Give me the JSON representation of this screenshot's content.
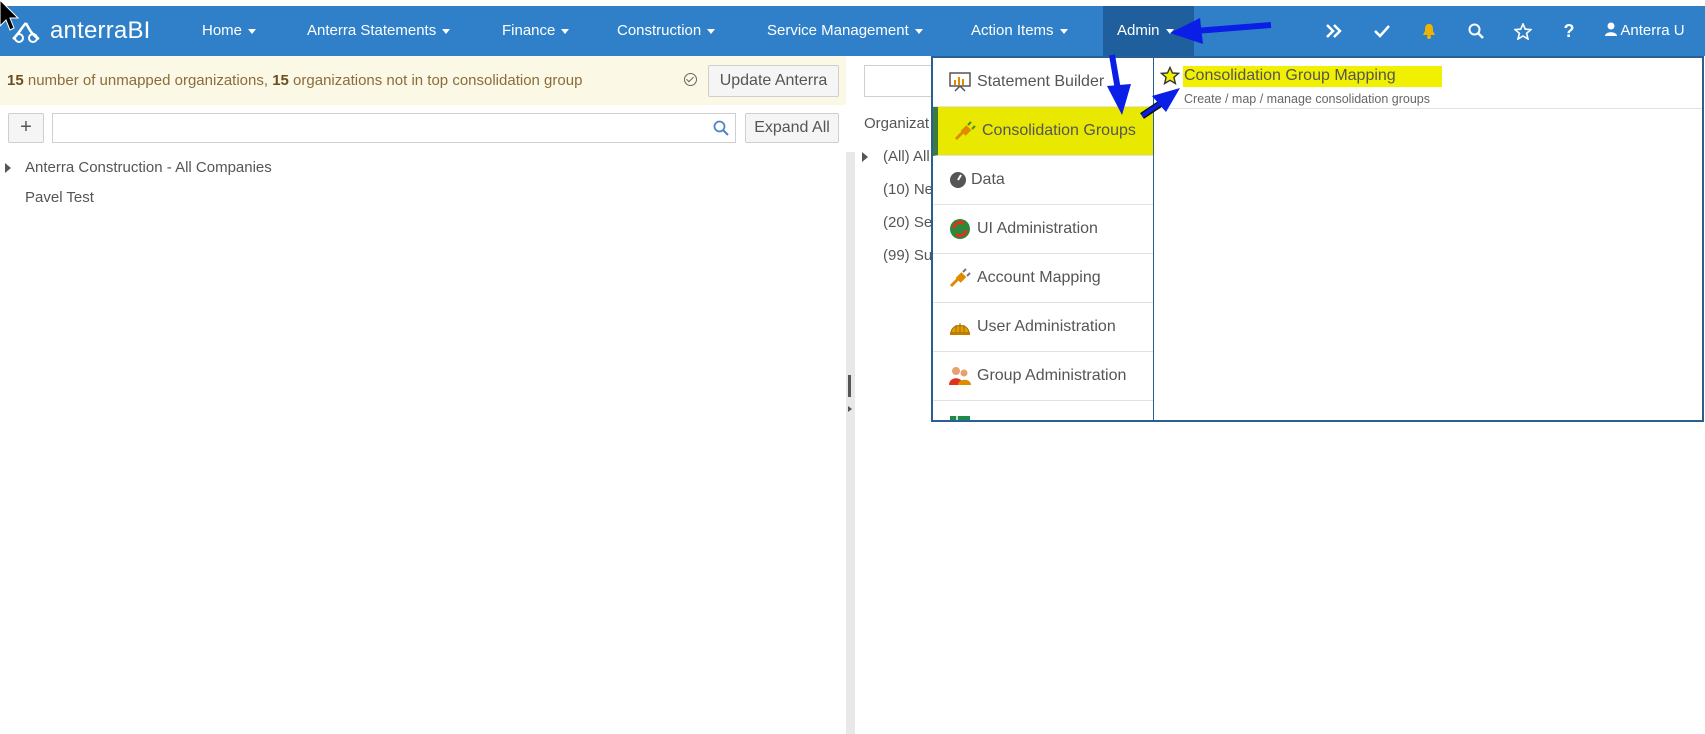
{
  "brand": {
    "name": "anterraBI"
  },
  "nav": {
    "items": [
      {
        "label": "Home"
      },
      {
        "label": "Anterra Statements"
      },
      {
        "label": "Finance"
      },
      {
        "label": "Construction"
      },
      {
        "label": "Service Management"
      },
      {
        "label": "Action Items"
      },
      {
        "label": "Admin"
      }
    ],
    "icons": [
      "double-chevron-right-icon",
      "check-icon",
      "bell-icon",
      "search-icon",
      "star-icon",
      "question-icon"
    ],
    "user_label": "Anterra U",
    "colors": {
      "bar": "#2f80c8",
      "active": "#1f5f9e",
      "bell": "#f0b400"
    }
  },
  "alert": {
    "count_unmapped": "15",
    "text_unmapped": " number of unmapped organizations, ",
    "count_not_top": "15",
    "text_not_top": " organizations not in top consolidation group",
    "update_button": "Update Anterra"
  },
  "toolbar": {
    "add_button": "+",
    "search_placeholder": "",
    "expand_button": "Expand All"
  },
  "tree": {
    "items": [
      {
        "label": "Anterra Construction - All Companies",
        "expandable": true
      },
      {
        "label": "Pavel Test",
        "expandable": false
      }
    ]
  },
  "right_pane": {
    "header": "Organizat",
    "items": [
      "(All) All",
      "(10) Ne",
      "(20) Se",
      "(99) Su"
    ]
  },
  "admin_menu": {
    "items": [
      {
        "label": "Statement Builder",
        "icon": "chart-board-icon"
      },
      {
        "label": "Consolidation Groups",
        "icon": "plug-icon",
        "active": true
      },
      {
        "label": "Data",
        "icon": "gauge-icon"
      },
      {
        "label": "UI Administration",
        "icon": "refresh-arrows-icon"
      },
      {
        "label": "Account Mapping",
        "icon": "plug-icon"
      },
      {
        "label": "User Administration",
        "icon": "hardhat-icon"
      },
      {
        "label": "Group Administration",
        "icon": "users-icon"
      },
      {
        "label": "",
        "icon": "spreadsheet-icon"
      }
    ],
    "submenu": {
      "title": "Consolidation Group Mapping",
      "description": "Create / map / manage consolidation groups"
    },
    "highlight_color": "#f0f000"
  }
}
